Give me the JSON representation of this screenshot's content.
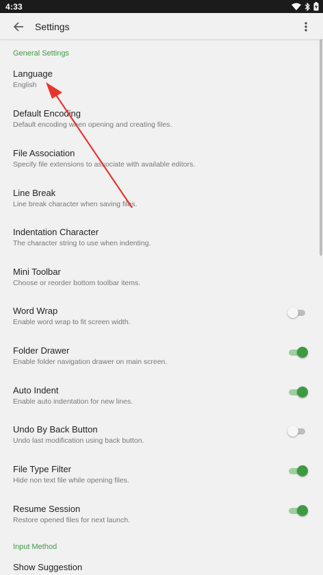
{
  "status_bar": {
    "time": "4:33"
  },
  "app_bar": {
    "title": "Settings"
  },
  "sections": {
    "general": {
      "header": "General Settings"
    },
    "input": {
      "header": "Input Method"
    }
  },
  "prefs": [
    {
      "title": "Language",
      "summary": "English"
    },
    {
      "title": "Default Encoding",
      "summary": "Default encoding when opening and creating files."
    },
    {
      "title": "File Association",
      "summary": "Specify file extensions to associate with available editors."
    },
    {
      "title": "Line Break",
      "summary": "Line break character when saving files."
    },
    {
      "title": "Indentation Character",
      "summary": "The character string to use when indenting."
    },
    {
      "title": "Mini Toolbar",
      "summary": "Choose or reorder bottom toolbar items."
    },
    {
      "title": "Word Wrap",
      "summary": "Enable word wrap to fit screen width.",
      "enabled": false
    },
    {
      "title": "Folder Drawer",
      "summary": "Enable folder navigation drawer on main screen.",
      "enabled": true
    },
    {
      "title": "Auto Indent",
      "summary": "Enable auto indentation for new lines.",
      "enabled": true
    },
    {
      "title": "Undo By Back Button",
      "summary": "Undo last modification using back button.",
      "enabled": false
    },
    {
      "title": "File Type Filter",
      "summary": "Hide non text file while opening files.",
      "enabled": true
    },
    {
      "title": "Resume Session",
      "summary": "Restore opened files for next launch.",
      "enabled": true
    },
    {
      "title": "Show Suggestion",
      "summary": ""
    }
  ],
  "colors": {
    "accent": "#3e9a41",
    "status_bar": "#1b1b1b",
    "background": "#f1f1f1",
    "annotation_arrow": "#e8342b"
  },
  "icons": {
    "back": "arrow-back-icon",
    "more": "more-vert-icon",
    "wifi": "wifi-icon",
    "bluetooth": "bluetooth-icon",
    "battery": "battery-charging-icon"
  }
}
